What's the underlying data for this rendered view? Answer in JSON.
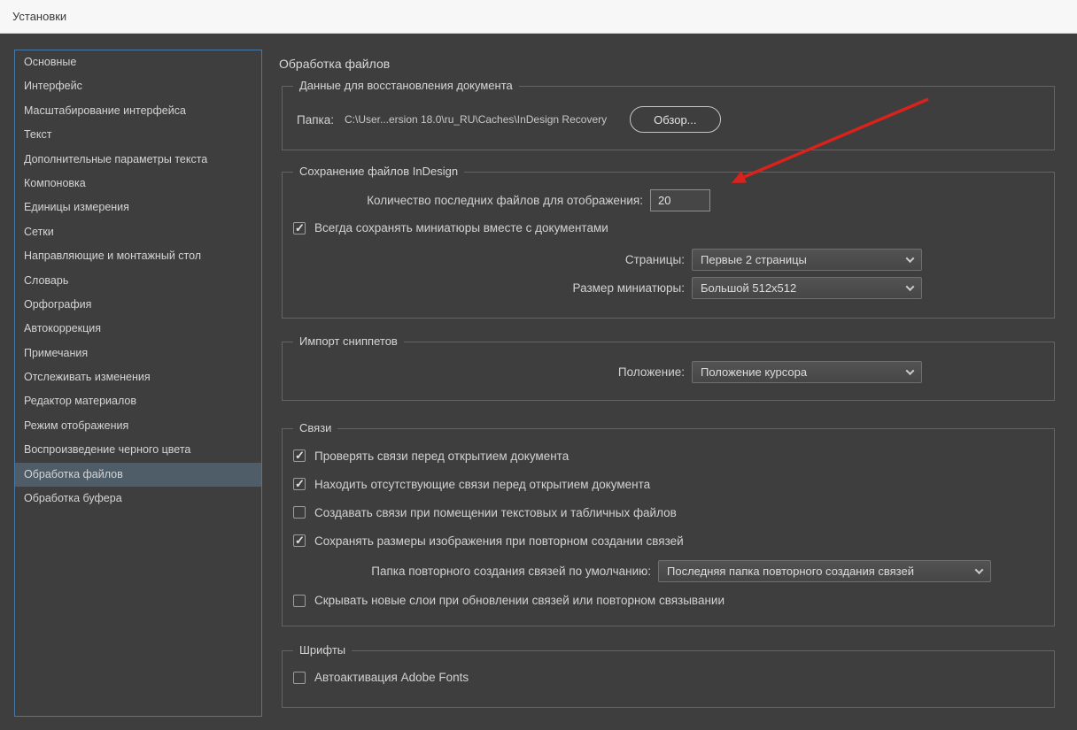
{
  "window": {
    "title": "Установки"
  },
  "sidebar": {
    "items": [
      {
        "label": "Основные",
        "selected": false
      },
      {
        "label": "Интерфейс",
        "selected": false
      },
      {
        "label": "Масштабирование интерфейса",
        "selected": false
      },
      {
        "label": "Текст",
        "selected": false
      },
      {
        "label": "Дополнительные параметры текста",
        "selected": false
      },
      {
        "label": "Компоновка",
        "selected": false
      },
      {
        "label": "Единицы измерения",
        "selected": false
      },
      {
        "label": "Сетки",
        "selected": false
      },
      {
        "label": "Направляющие и монтажный стол",
        "selected": false
      },
      {
        "label": "Словарь",
        "selected": false
      },
      {
        "label": "Орфография",
        "selected": false
      },
      {
        "label": "Автокоррекция",
        "selected": false
      },
      {
        "label": "Примечания",
        "selected": false
      },
      {
        "label": "Отслеживать изменения",
        "selected": false
      },
      {
        "label": "Редактор материалов",
        "selected": false
      },
      {
        "label": "Режим отображения",
        "selected": false
      },
      {
        "label": "Воспроизведение черного цвета",
        "selected": false
      },
      {
        "label": "Обработка файлов",
        "selected": true
      },
      {
        "label": "Обработка буфера",
        "selected": false
      }
    ]
  },
  "main": {
    "title": "Обработка файлов",
    "recovery": {
      "legend": "Данные для восстановления документа",
      "folder_label": "Папка:",
      "folder_path": "C:\\User...ersion 18.0\\ru_RU\\Caches\\InDesign Recovery",
      "browse_button": "Обзор..."
    },
    "saving": {
      "legend": "Сохранение файлов InDesign",
      "recent_files_label": "Количество последних файлов для отображения:",
      "recent_files_value": "20",
      "thumbnails_checkbox": {
        "label": "Всегда сохранять миниатюры вместе с документами",
        "checked": true
      },
      "pages_label": "Страницы:",
      "pages_value": "Первые 2 страницы",
      "thumb_size_label": "Размер миниатюры:",
      "thumb_size_value": "Большой 512x512"
    },
    "snippets": {
      "legend": "Импорт сниппетов",
      "position_label": "Положение:",
      "position_value": "Положение курсора"
    },
    "links": {
      "legend": "Связи",
      "checkboxes": [
        {
          "label": "Проверять связи перед открытием документа",
          "checked": true
        },
        {
          "label": "Находить отсутствующие связи перед открытием документа",
          "checked": true
        },
        {
          "label": "Создавать связи при помещении текстовых и табличных файлов",
          "checked": false
        },
        {
          "label": "Сохранять размеры изображения при повторном создании связей",
          "checked": true
        }
      ],
      "relink_folder_label": "Папка повторного создания связей по умолчанию:",
      "relink_folder_value": "Последняя папка повторного создания связей",
      "hide_layers_checkbox": {
        "label": "Скрывать новые слои при обновлении связей или повторном связывании",
        "checked": false
      }
    },
    "fonts": {
      "legend": "Шрифты",
      "auto_activate_checkbox": {
        "label": "Автоактивация Adobe Fonts",
        "checked": false
      }
    }
  },
  "annotation": {
    "arrow_color": "#d9221c"
  }
}
